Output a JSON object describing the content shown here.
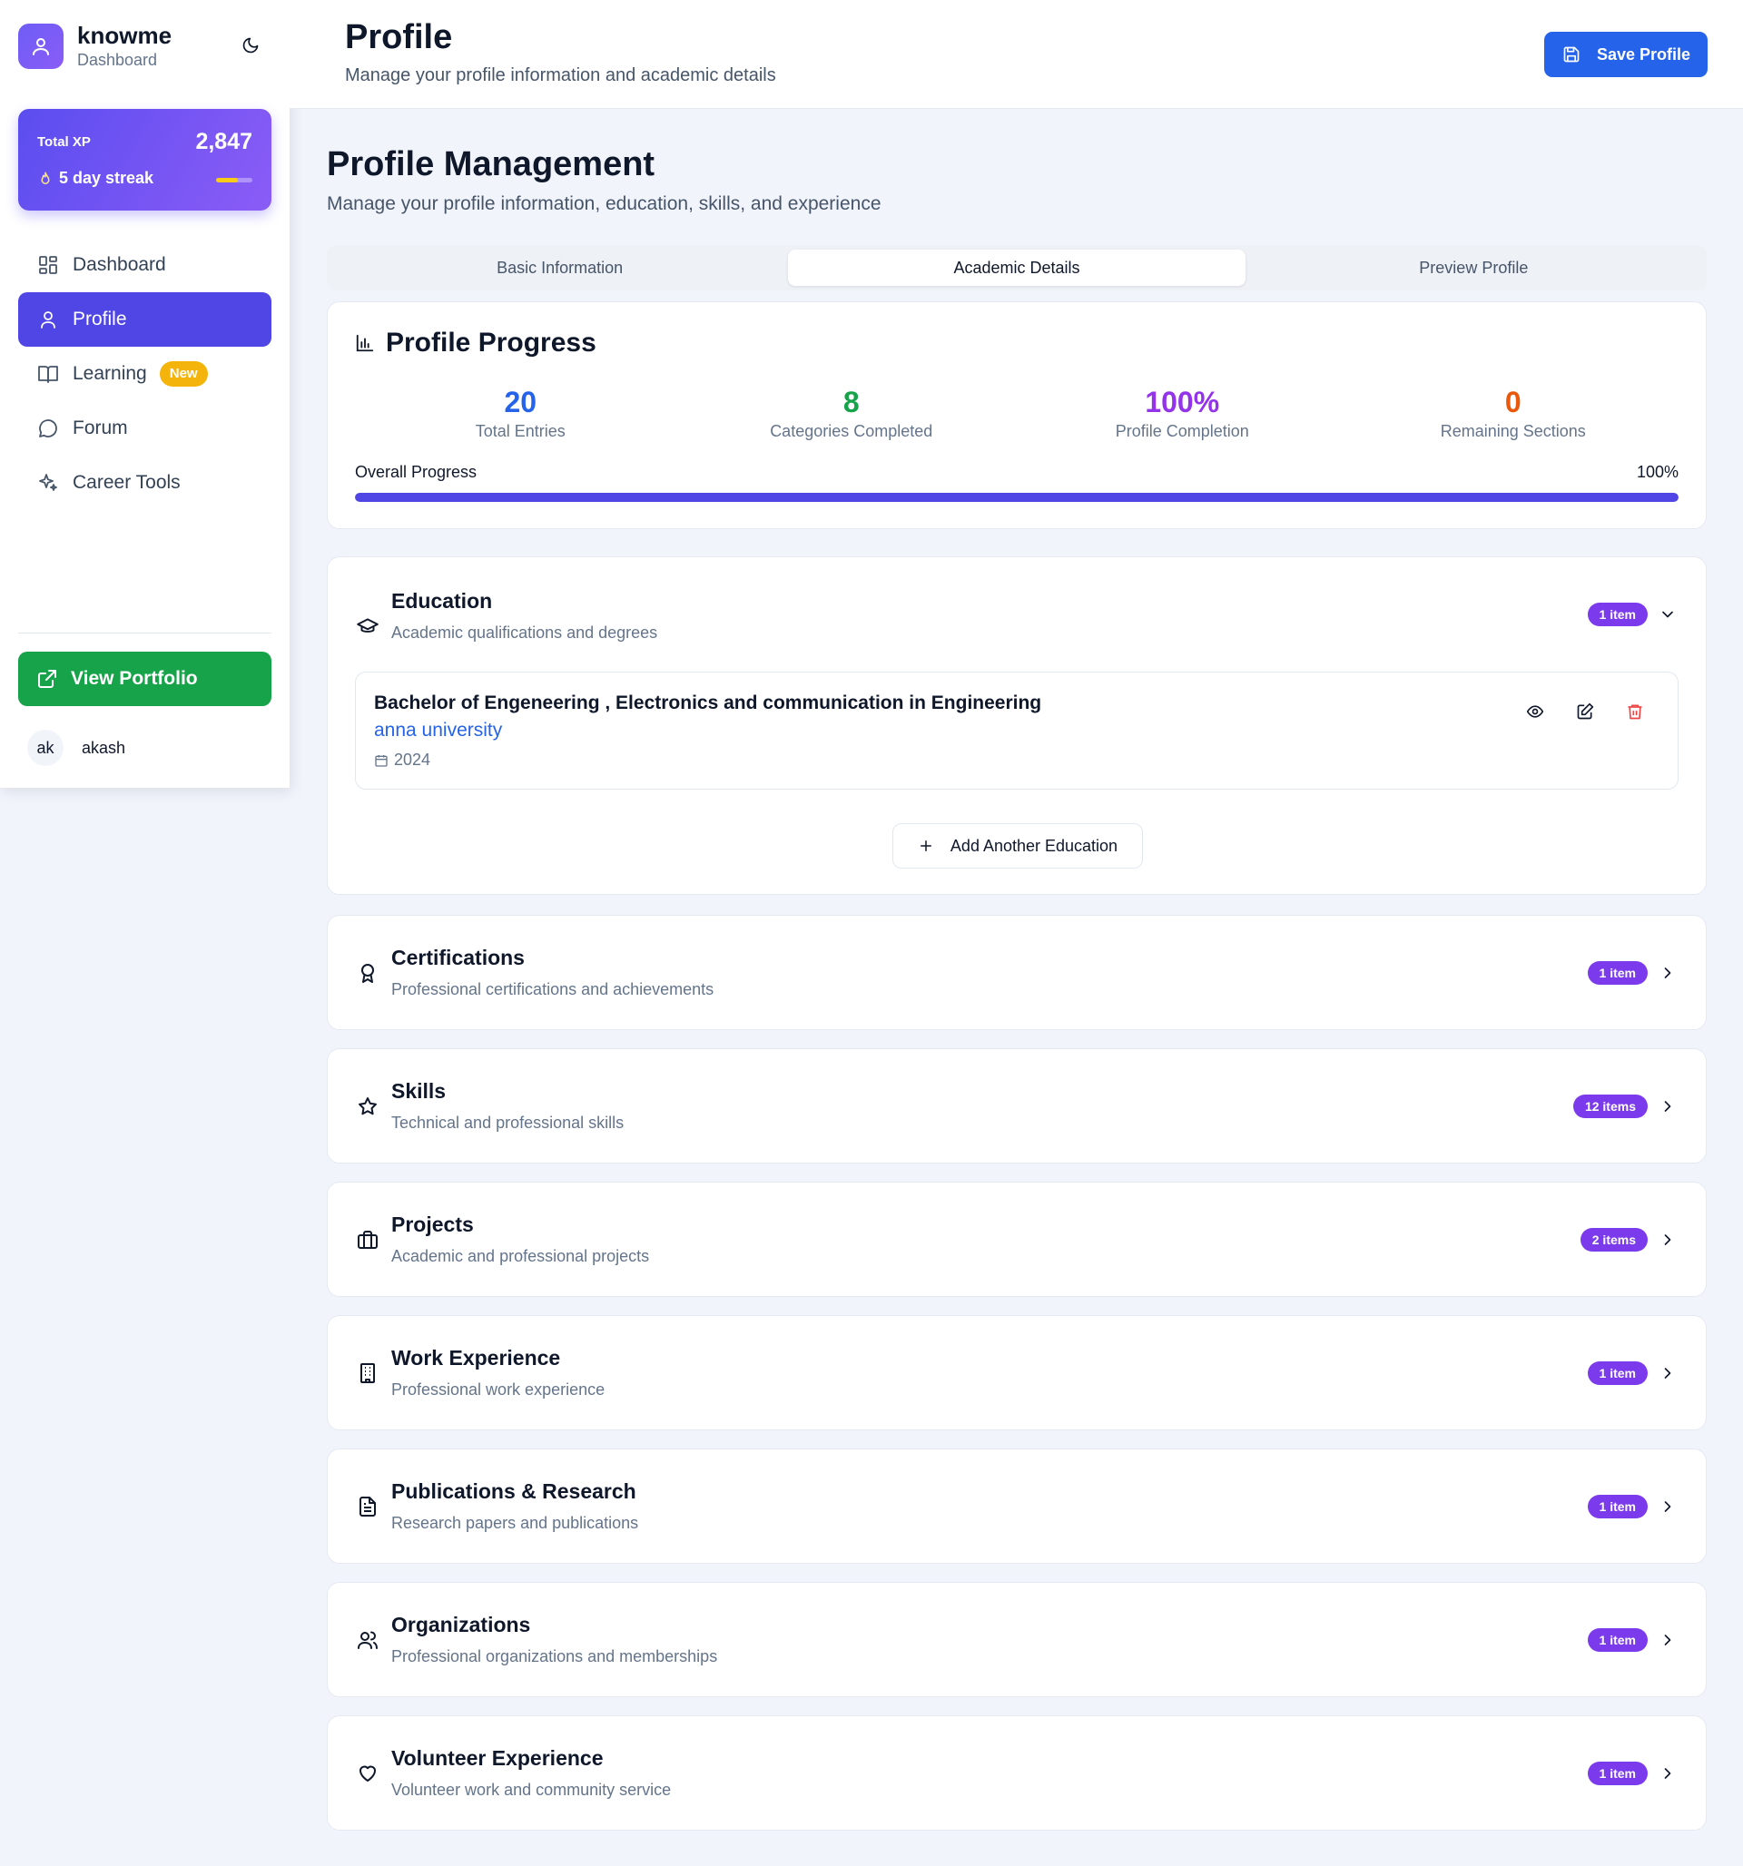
{
  "brand": {
    "name": "knowme",
    "subtitle": "Dashboard",
    "logo_icon": "user-icon",
    "theme_icon": "moon-icon"
  },
  "xp": {
    "label": "Total XP",
    "value": "2,847",
    "streak": "5 day streak",
    "streak_icon": "flame-icon",
    "streak_progress": 0.6
  },
  "nav": {
    "items": [
      {
        "label": "Dashboard",
        "icon": "grid-icon",
        "active": false
      },
      {
        "label": "Profile",
        "icon": "user-icon",
        "active": true
      },
      {
        "label": "Learning",
        "icon": "book-icon",
        "active": false,
        "badge": "New"
      },
      {
        "label": "Forum",
        "icon": "chat-icon",
        "active": false
      },
      {
        "label": "Career Tools",
        "icon": "sparkles-icon",
        "active": false
      }
    ]
  },
  "portfolio": {
    "label": "View Portfolio",
    "icon": "external-link-icon"
  },
  "user": {
    "initials": "ak",
    "name": "akash"
  },
  "header": {
    "title": "Profile",
    "subtitle": "Manage your profile information and academic details",
    "save_label": "Save Profile"
  },
  "main": {
    "title": "Profile Management",
    "subtitle": "Manage your profile information, education, skills, and experience",
    "tabs": [
      {
        "label": "Basic Information",
        "active": false
      },
      {
        "label": "Academic Details",
        "active": true
      },
      {
        "label": "Preview Profile",
        "active": false
      }
    ]
  },
  "progress": {
    "title": "Profile Progress",
    "stats": [
      {
        "value": "20",
        "label": "Total Entries",
        "color": "#2563eb"
      },
      {
        "value": "8",
        "label": "Categories Completed",
        "color": "#16a34a"
      },
      {
        "value": "100%",
        "label": "Profile Completion",
        "color": "#9333ea"
      },
      {
        "value": "0",
        "label": "Remaining Sections",
        "color": "#ea580c"
      }
    ],
    "overall_label": "Overall Progress",
    "overall_pct": "100%",
    "overall_value": 1.0
  },
  "education": {
    "title": "Education",
    "description": "Academic qualifications and degrees",
    "badge": "1 item",
    "entry": {
      "degree": "Bachelor of Engeneering , Electronics and communication in Engineering",
      "institution": "anna university",
      "year": "2024"
    },
    "add_label": "Add Another Education"
  },
  "sections": [
    {
      "title": "Certifications",
      "description": "Professional certifications and achievements",
      "badge": "1 item",
      "icon": "award-icon"
    },
    {
      "title": "Skills",
      "description": "Technical and professional skills",
      "badge": "12 items",
      "icon": "star-icon"
    },
    {
      "title": "Projects",
      "description": "Academic and professional projects",
      "badge": "2 items",
      "icon": "briefcase-icon"
    },
    {
      "title": "Work Experience",
      "description": "Professional work experience",
      "badge": "1 item",
      "icon": "building-icon"
    },
    {
      "title": "Publications & Research",
      "description": "Research papers and publications",
      "badge": "1 item",
      "icon": "document-icon"
    },
    {
      "title": "Organizations",
      "description": "Professional organizations and memberships",
      "badge": "1 item",
      "icon": "users-icon"
    },
    {
      "title": "Volunteer Experience",
      "description": "Volunteer work and community service",
      "badge": "1 item",
      "icon": "heart-icon"
    }
  ]
}
